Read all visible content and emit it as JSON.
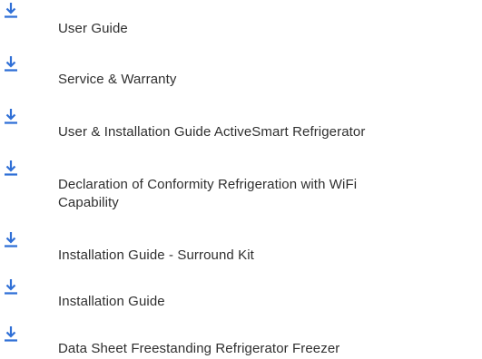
{
  "colors": {
    "icon": "#2f6fd6",
    "text": "#2f2f2f",
    "background": "#ffffff"
  },
  "documents": [
    {
      "label": "User Guide",
      "icon": "download-icon"
    },
    {
      "label": "Service & Warranty",
      "icon": "download-icon"
    },
    {
      "label": "User & Installation Guide ActiveSmart Refrigerator",
      "icon": "download-icon"
    },
    {
      "label": "Declaration of Conformity Refrigeration with WiFi Capability",
      "icon": "download-icon"
    },
    {
      "label": "Installation Guide - Surround Kit",
      "icon": "download-icon"
    },
    {
      "label": "Installation Guide",
      "icon": "download-icon"
    },
    {
      "label": "Data Sheet Freestanding Refrigerator Freezer",
      "icon": "download-icon"
    }
  ]
}
